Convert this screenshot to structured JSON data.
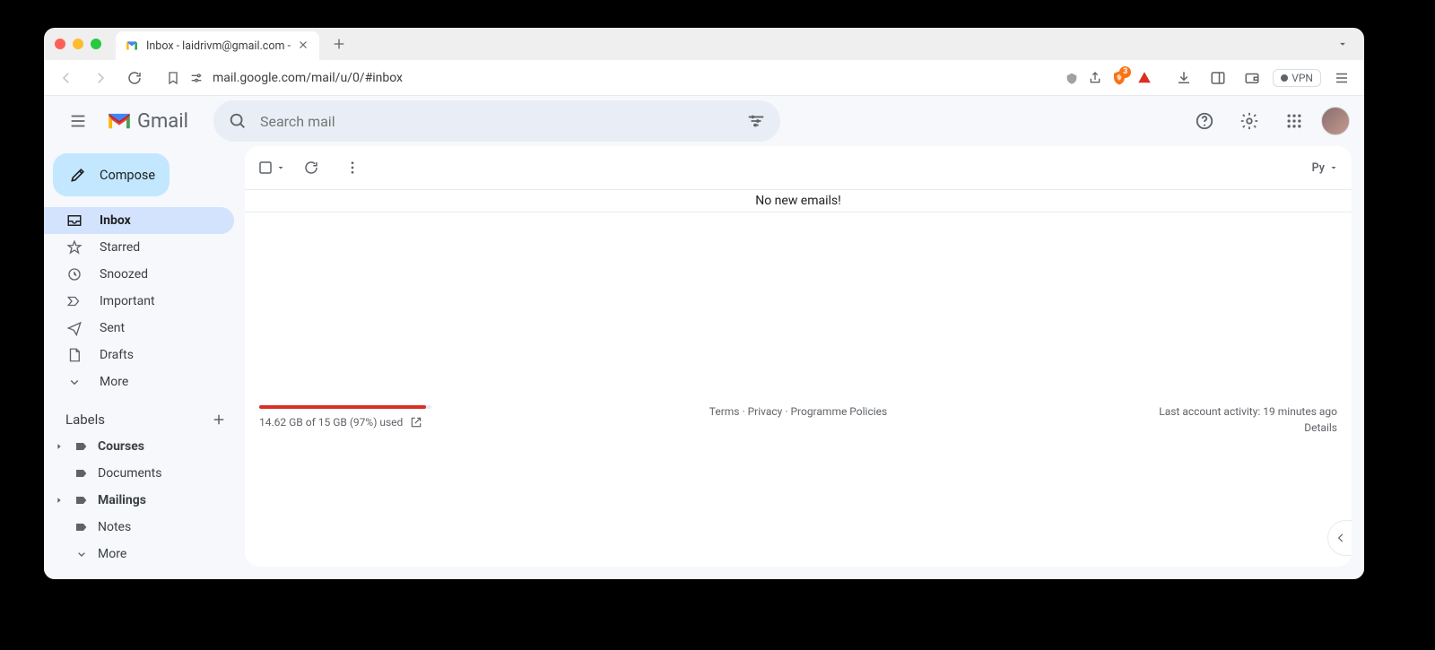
{
  "browser": {
    "tab_title": "Inbox - laidrivm@gmail.com -",
    "url": "mail.google.com/mail/u/0/#inbox",
    "shield_badge": "3",
    "vpn_label": "VPN"
  },
  "gmail": {
    "product_name": "Gmail",
    "search_placeholder": "Search mail",
    "compose_label": "Compose",
    "nav": {
      "inbox": "Inbox",
      "starred": "Starred",
      "snoozed": "Snoozed",
      "important": "Important",
      "sent": "Sent",
      "drafts": "Drafts",
      "more": "More"
    },
    "labels_header": "Labels",
    "labels": {
      "courses": "Courses",
      "documents": "Documents",
      "mailings": "Mailings",
      "notes": "Notes",
      "more": "More"
    },
    "input_tool_label": "Py",
    "empty_message": "No new emails!",
    "storage": {
      "text": "14.62 GB of 15 GB (97%) used",
      "percent": 97
    },
    "footer_links": {
      "terms": "Terms",
      "privacy": "Privacy",
      "policies": "Programme Policies"
    },
    "activity": {
      "text": "Last account activity: 19 minutes ago",
      "details": "Details"
    }
  }
}
